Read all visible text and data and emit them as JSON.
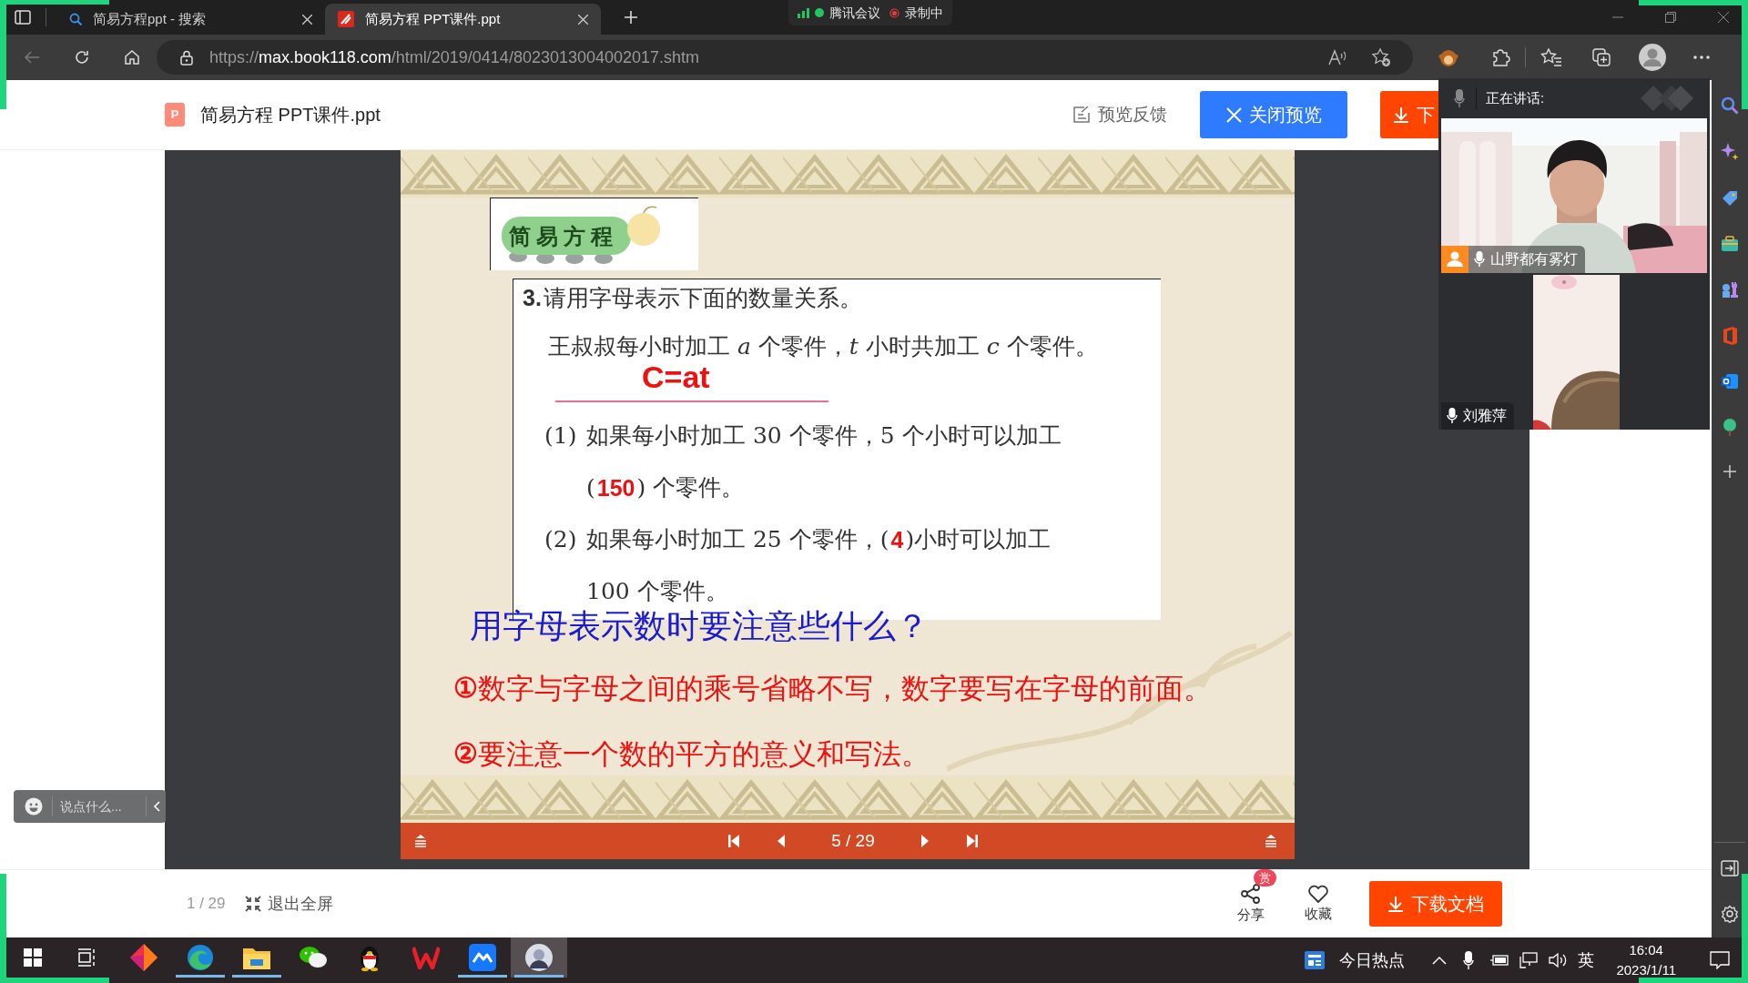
{
  "browser": {
    "tabs": [
      {
        "label": "简易方程ppt - 搜索",
        "kind": "search",
        "selected": false
      },
      {
        "label": "简易方程 PPT课件.ppt",
        "kind": "document",
        "selected": true
      }
    ],
    "address": {
      "scheme": "https://",
      "host": "max.book118.com",
      "path": "/html/2019/0414/8023013004002017.shtm"
    }
  },
  "meeting_status": {
    "app": "腾讯会议",
    "recording": "录制中"
  },
  "document_header": {
    "file_badge": "P",
    "title": "简易方程 PPT课件.ppt",
    "feedback": "预览反馈",
    "close_preview": "关闭预览",
    "download": "下"
  },
  "slide": {
    "badge": "简易方程",
    "question_number": "3.",
    "question": "请用字母表示下面的数量关系。",
    "statement": "王叔叔每小时加工 *a* 个零件，*t* 小时共加工 *c* 个零件。",
    "answer": "C=at",
    "parts": [
      {
        "label": "(1)",
        "lines": [
          [
            {
              "kind": "text",
              "text": "如果每小时加工 30 个零件，5 个小时可以加工"
            }
          ],
          [
            {
              "kind": "text",
              "text": "("
            },
            {
              "kind": "answer",
              "text": "150"
            },
            {
              "kind": "text",
              "text": ") 个零件。"
            }
          ]
        ]
      },
      {
        "label": "(2)",
        "lines": [
          [
            {
              "kind": "text",
              "text": "如果每小时加工 25 个零件，("
            },
            {
              "kind": "answer",
              "text": "4"
            },
            {
              "kind": "text",
              "text": ")小时可以加工"
            }
          ],
          [
            {
              "kind": "text",
              "text": "100 个零件。"
            }
          ]
        ]
      }
    ],
    "prompt": "用字母表示数时要注意些什么？",
    "notes": [
      {
        "mark": "①",
        "text": "数字与字母之间的乘号省略不写，数字要写在字母的前面。"
      },
      {
        "mark": "②",
        "text": "要注意一个数的平方的意义和写法。"
      }
    ]
  },
  "viewer_bar": {
    "page": "5 / 29"
  },
  "meeting": {
    "speaking_label": "正在讲话:",
    "participants": [
      {
        "name": "山野都有雾灯",
        "host": true,
        "kind": "wide"
      },
      {
        "name": "刘雅萍",
        "host": false,
        "kind": "portrait"
      }
    ]
  },
  "chat": {
    "placeholder": "说点什么..."
  },
  "footer": {
    "page": "1 / 29",
    "exit_fullscreen": "退出全屏",
    "share": "分享",
    "reward_badge": "赏",
    "favorite": "收藏",
    "download": "下载文档"
  },
  "taskbar": {
    "apps": [
      {
        "kind": "start",
        "running": false,
        "selected": false
      },
      {
        "kind": "taskview",
        "running": false,
        "selected": false
      },
      {
        "kind": "diamond",
        "running": false,
        "selected": false
      },
      {
        "kind": "edge",
        "running": true,
        "selected": false
      },
      {
        "kind": "folder",
        "running": true,
        "selected": false
      },
      {
        "kind": "chat",
        "running": false,
        "selected": false
      },
      {
        "kind": "penguin",
        "running": false,
        "selected": false
      },
      {
        "kind": "office",
        "running": false,
        "selected": false
      },
      {
        "kind": "meeting",
        "running": true,
        "selected": false
      },
      {
        "kind": "avatar",
        "running": true,
        "selected": true
      }
    ],
    "news": "今日热点",
    "ime": "英",
    "time": "16:04",
    "date": "2023/1/11"
  }
}
